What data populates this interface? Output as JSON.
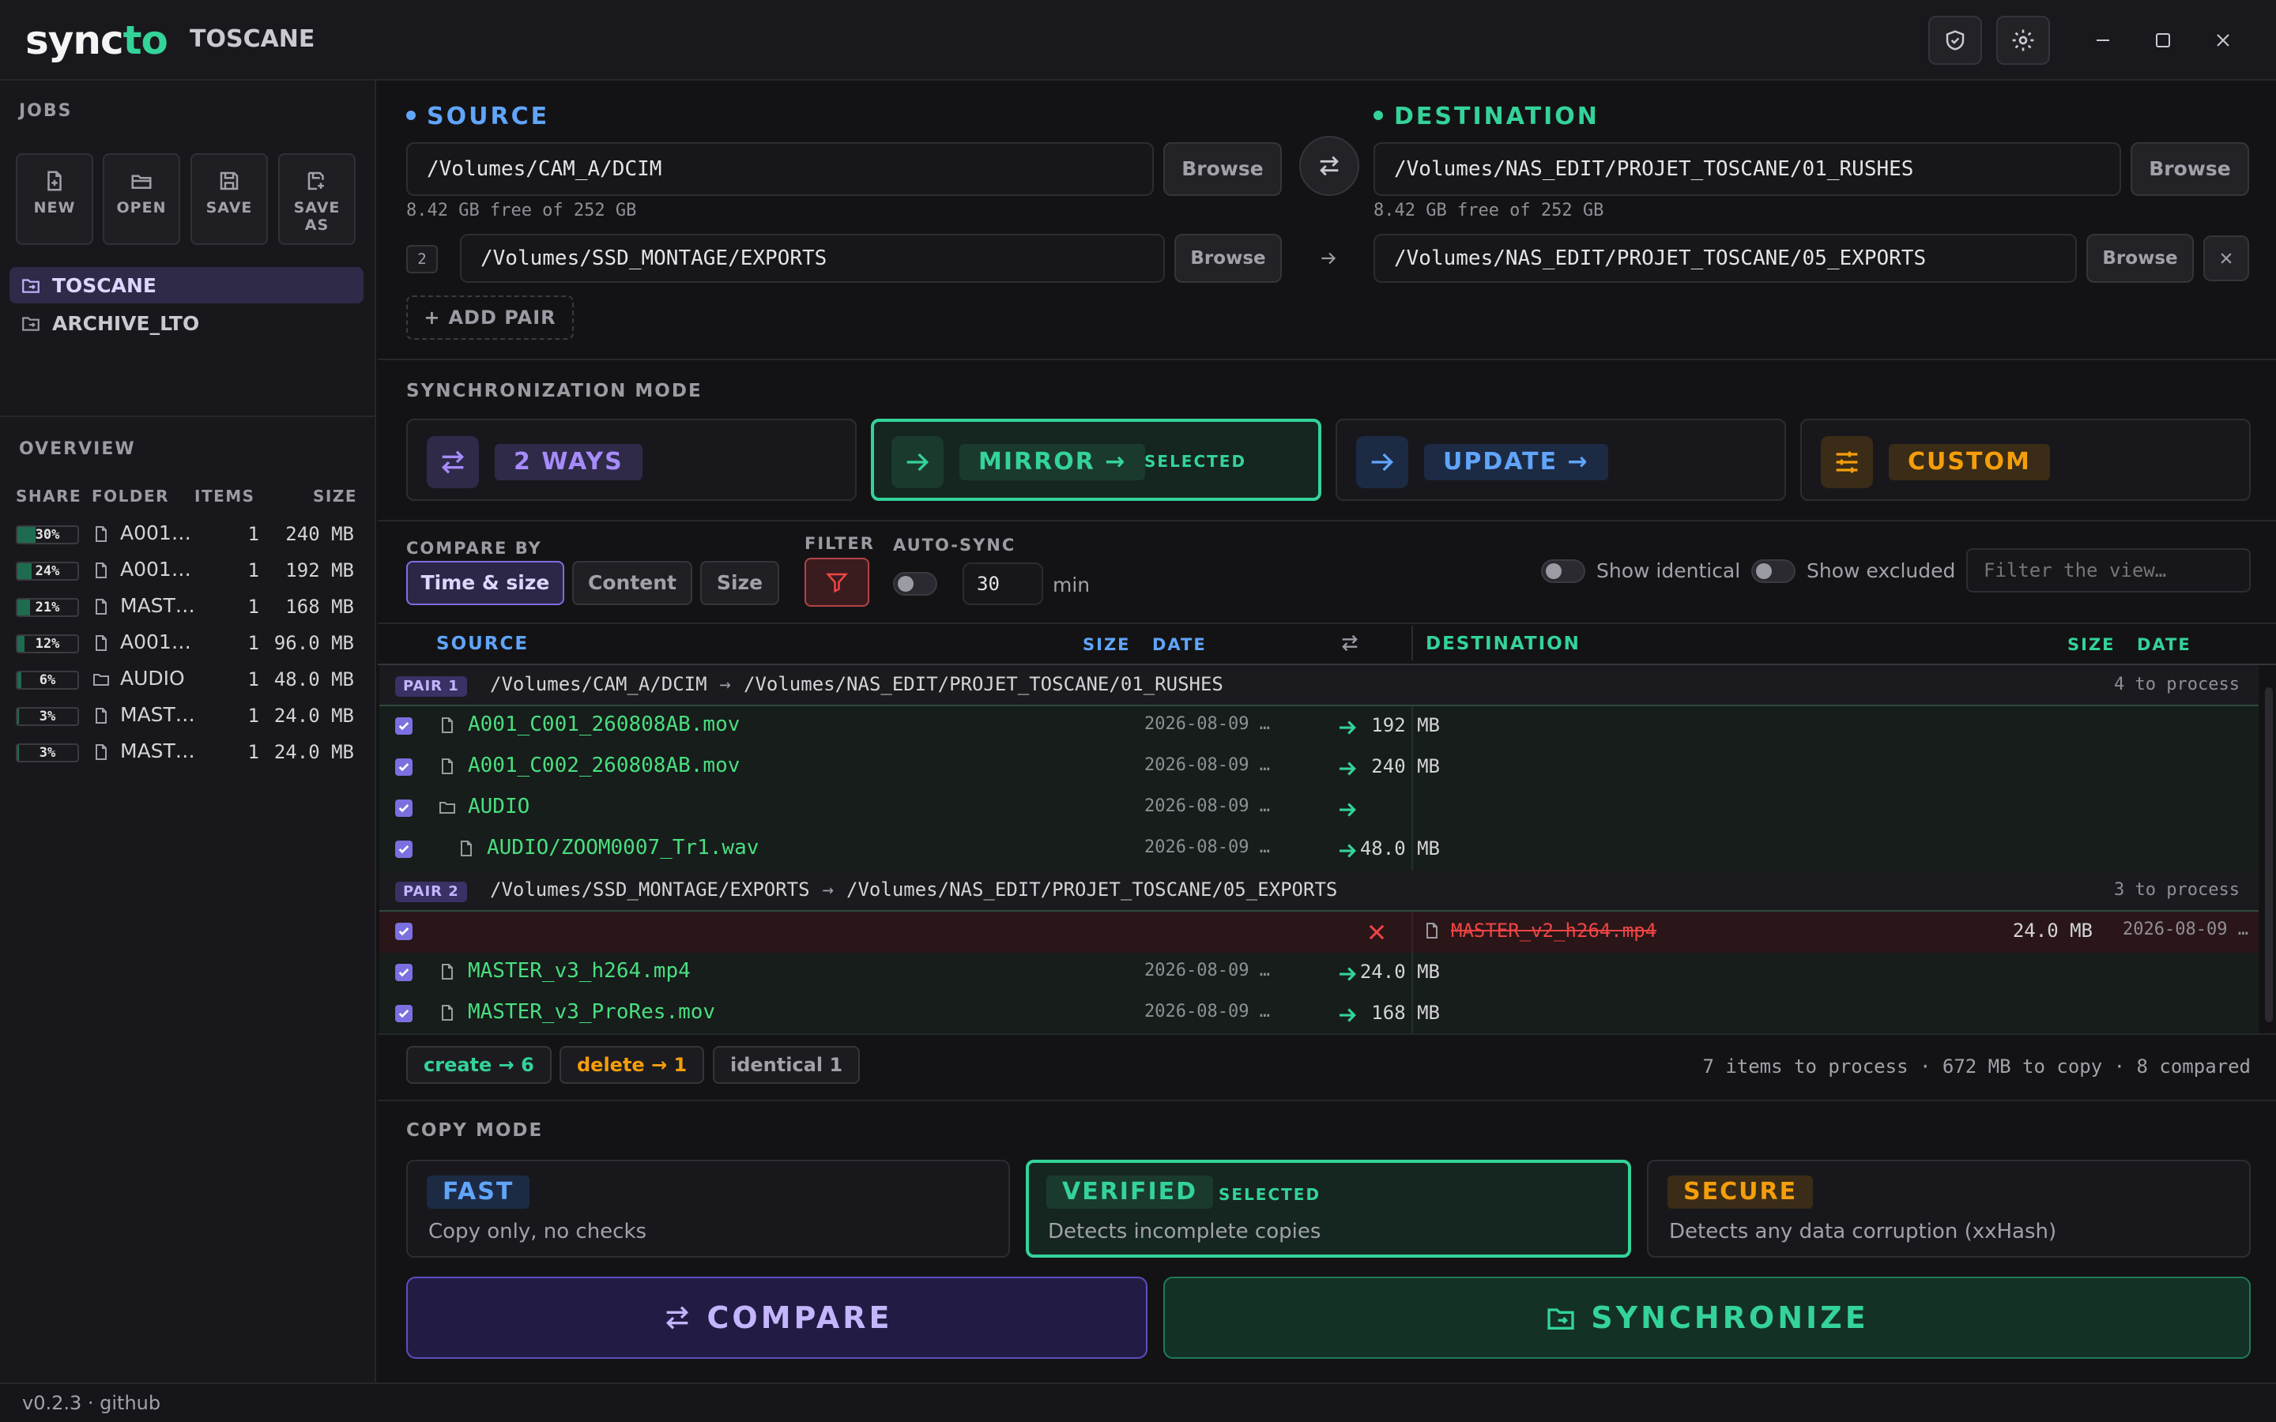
{
  "app": {
    "logo_sync": "sync",
    "logo_to": "to",
    "job_title": "TOSCANE"
  },
  "sidebar": {
    "jobs_heading": "JOBS",
    "buttons": [
      {
        "label": "NEW",
        "icon": "file-plus-icon"
      },
      {
        "label": "OPEN",
        "icon": "folder-open-icon"
      },
      {
        "label": "SAVE",
        "icon": "save-icon"
      },
      {
        "label": "SAVE AS",
        "icon": "save-as-icon"
      }
    ],
    "jobs": [
      {
        "name": "TOSCANE",
        "active": true
      },
      {
        "name": "ARCHIVE_LTO",
        "active": false
      }
    ],
    "overview_heading": "OVERVIEW",
    "overview_columns": {
      "share": "SHARE",
      "folder": "FOLDER",
      "items": "ITEMS",
      "size": "SIZE"
    },
    "overview_rows": [
      {
        "share": "30%",
        "share_value": 30,
        "type": "file",
        "folder": "A001…",
        "items": "1",
        "size": "240 MB"
      },
      {
        "share": "24%",
        "share_value": 24,
        "type": "file",
        "folder": "A001…",
        "items": "1",
        "size": "192 MB"
      },
      {
        "share": "21%",
        "share_value": 21,
        "type": "file",
        "folder": "MAST…",
        "items": "1",
        "size": "168 MB"
      },
      {
        "share": "12%",
        "share_value": 12,
        "type": "file",
        "folder": "A001…",
        "items": "1",
        "size": "96.0 MB"
      },
      {
        "share": "6%",
        "share_value": 6,
        "type": "folder",
        "folder": "AUDIO",
        "items": "1",
        "size": "48.0 MB"
      },
      {
        "share": "3%",
        "share_value": 3,
        "type": "file",
        "folder": "MAST…",
        "items": "1",
        "size": "24.0 MB"
      },
      {
        "share": "3%",
        "share_value": 3,
        "type": "file",
        "folder": "MAST…",
        "items": "1",
        "size": "24.0 MB"
      }
    ]
  },
  "status": {
    "text": "v0.2.3 · github"
  },
  "source": {
    "heading": "SOURCE",
    "path1": "/Volumes/CAM_A/DCIM",
    "free": "8.42 GB free of 252 GB",
    "pair2_num": "2",
    "path2": "/Volumes/SSD_MONTAGE/EXPORTS",
    "browse": "Browse",
    "color": "#60a5fa"
  },
  "destination": {
    "heading": "DESTINATION",
    "path1": "/Volumes/NAS_EDIT/PROJET_TOSCANE/01_RUSHES",
    "free": "8.42 GB free of 252 GB",
    "path2": "/Volumes/NAS_EDIT/PROJET_TOSCANE/05_EXPORTS",
    "browse": "Browse",
    "color": "#34d399"
  },
  "add_pair": "ADD PAIR",
  "sync_mode": {
    "heading": "SYNCHRONIZATION MODE",
    "modes": [
      {
        "label": "2 WAYS"
      },
      {
        "label": "MIRROR →",
        "selected_tag": "SELECTED"
      },
      {
        "label": "UPDATE →"
      },
      {
        "label": "CUSTOM"
      }
    ]
  },
  "compare": {
    "heading": "COMPARE BY",
    "options": [
      "Time & size",
      "Content",
      "Size"
    ],
    "active": "Time & size"
  },
  "filter": {
    "heading": "FILTER"
  },
  "autosync": {
    "heading": "AUTO-SYNC",
    "value": "30",
    "unit": "min"
  },
  "view": {
    "show_identical": "Show identical",
    "show_excluded": "Show excluded",
    "filter_placeholder": "Filter the view…"
  },
  "table": {
    "headers": {
      "source": "SOURCE",
      "size": "SIZE",
      "date": "DATE",
      "destination": "DESTINATION",
      "dsize": "SIZE",
      "ddate": "DATE"
    },
    "pair1": {
      "tag": "PAIR 1",
      "src": "/Volumes/CAM_A/DCIM",
      "arrow": "→",
      "dst": "/Volumes/NAS_EDIT/PROJET_TOSCANE/01_RUSHES",
      "count": "4 to process"
    },
    "pair1_rows": [
      {
        "name": "A001_C001_260808AB.mov",
        "size": "192 MB",
        "date": "2026-08-09 …",
        "type": "file"
      },
      {
        "name": "A001_C002_260808AB.mov",
        "size": "240 MB",
        "date": "2026-08-09 …",
        "type": "file"
      },
      {
        "name": "AUDIO",
        "size": "",
        "date": "2026-08-09 …",
        "type": "folder"
      },
      {
        "name": "AUDIO/ZOOM0007_Tr1.wav",
        "size": "48.0 MB",
        "date": "2026-08-09 …",
        "type": "file"
      }
    ],
    "pair2": {
      "tag": "PAIR 2",
      "src": "/Volumes/SSD_MONTAGE/EXPORTS",
      "arrow": "→",
      "dst": "/Volumes/NAS_EDIT/PROJET_TOSCANE/05_EXPORTS",
      "count": "3 to process"
    },
    "delete_row": {
      "name": "MASTER_v2_h264.mp4",
      "size": "24.0 MB",
      "date": "2026-08-09 …"
    },
    "pair2_rows": [
      {
        "name": "MASTER_v3_h264.mp4",
        "size": "24.0 MB",
        "date": "2026-08-09 …",
        "type": "file"
      },
      {
        "name": "MASTER_v3_ProRes.mov",
        "size": "168 MB",
        "date": "2026-08-09 …",
        "type": "file"
      }
    ]
  },
  "summary": {
    "create": "create → 6",
    "delete": "delete → 1",
    "identical": "identical 1",
    "totals": "7 items to process · 672 MB to copy · 8 compared"
  },
  "copy_mode": {
    "heading": "COPY MODE",
    "modes": [
      {
        "label": "FAST",
        "desc": "Copy only, no checks"
      },
      {
        "label": "VERIFIED",
        "desc": "Detects incomplete copies",
        "selected_tag": "SELECTED"
      },
      {
        "label": "SECURE",
        "desc": "Detects any data corruption (xxHash)"
      }
    ]
  },
  "actions": {
    "compare": "COMPARE",
    "synchronize": "SYNCHRONIZE"
  },
  "colors": {
    "accent_green": "#34d399",
    "accent_purple": "#7c6fe0",
    "source_blue": "#60a5fa",
    "custom_orange": "#f59e0b",
    "delete_red": "#ef4444"
  }
}
